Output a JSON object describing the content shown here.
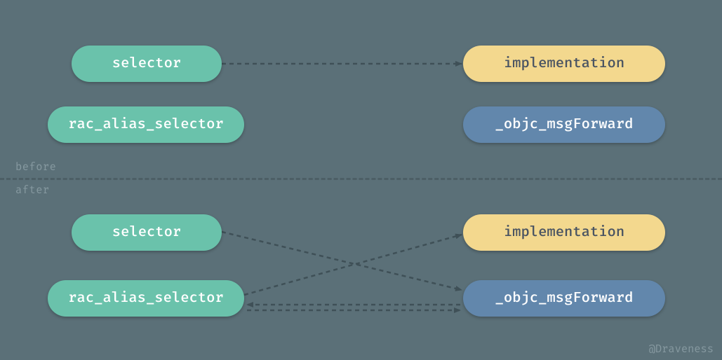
{
  "colors": {
    "bg": "#5b7078",
    "teal": "#6ac2ab",
    "yellow": "#f3d88e",
    "blue": "#6287ac",
    "divider": "#4c5e65",
    "muted": "#8699a0"
  },
  "divider": {
    "before": "before",
    "after": "after"
  },
  "credit": "@Draveness",
  "nodes": {
    "before_selector": "selector",
    "before_rac": "rac_alias_selector",
    "before_impl": "implementation",
    "before_msg": "_objc_msgForward",
    "after_selector": "selector",
    "after_rac": "rac_alias_selector",
    "after_impl": "implementation",
    "after_msg": "_objc_msgForward"
  }
}
